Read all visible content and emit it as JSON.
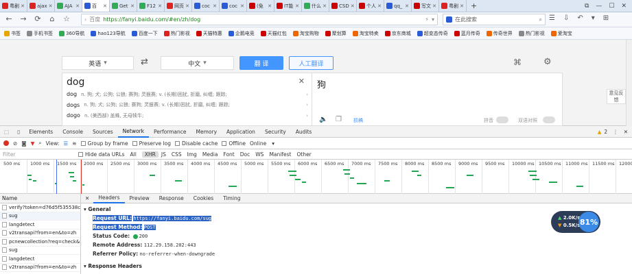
{
  "tabs": [
    {
      "title": "粤剧",
      "color": "#d22"
    },
    {
      "title": "ajax",
      "color": "#d22"
    },
    {
      "title": "AJA",
      "color": "#3a5"
    },
    {
      "title": "百",
      "color": "#2a5bd7",
      "active": true
    },
    {
      "title": "Get",
      "color": "#3a5"
    },
    {
      "title": "F12",
      "color": "#3a5"
    },
    {
      "title": "网页",
      "color": "#d22"
    },
    {
      "title": "coc",
      "color": "#2a5bd7"
    },
    {
      "title": "coc",
      "color": "#2a5bd7"
    },
    {
      "title": "(免",
      "color": "#c00"
    },
    {
      "title": "IT能",
      "color": "#c00"
    },
    {
      "title": "什么",
      "color": "#3a5"
    },
    {
      "title": "CSD",
      "color": "#c00"
    },
    {
      "title": "个人",
      "color": "#c00"
    },
    {
      "title": "qq_",
      "color": "#2a5bd7"
    },
    {
      "title": "写文",
      "color": "#c00"
    },
    {
      "title": "粤剧",
      "color": "#d22"
    }
  ],
  "nav": {
    "url_prefix": "百度",
    "url": "https://fanyi.baidu.com/#en/zh/dog",
    "search_placeholder": "在此搜索"
  },
  "bookmarks": [
    {
      "label": "书签",
      "color": "#e8a500"
    },
    {
      "label": "手机书签",
      "color": "#888"
    },
    {
      "label": "360导航",
      "color": "#3a5"
    },
    {
      "label": "hao123导航",
      "color": "#2a5bd7"
    },
    {
      "label": "百度一下",
      "color": "#2a5bd7"
    },
    {
      "label": "热门影视",
      "color": "#d22"
    },
    {
      "label": "天猫特惠",
      "color": "#c00"
    },
    {
      "label": "企鹅电竞",
      "color": "#2a5bd7"
    },
    {
      "label": "天猫红包",
      "color": "#c00"
    },
    {
      "label": "淘宝购物",
      "color": "#e60"
    },
    {
      "label": "聚划算",
      "color": "#c00"
    },
    {
      "label": "淘宝特卖",
      "color": "#e60"
    },
    {
      "label": "京东商城",
      "color": "#c00"
    },
    {
      "label": "超变态传奇",
      "color": "#2a5bd7"
    },
    {
      "label": "蓝月传奇",
      "color": "#c00"
    },
    {
      "label": "传奇世界",
      "color": "#e60"
    },
    {
      "label": "热门影视",
      "color": "#888"
    },
    {
      "label": "爱淘宝",
      "color": "#e60"
    }
  ],
  "translate": {
    "src_lang": "英语",
    "swap_icon": "⇄",
    "dst_lang": "中文",
    "translate_btn": "翻 译",
    "human_btn": "人工翻译",
    "input_word": "dog",
    "result": "狗",
    "suggestions": [
      {
        "word": "dog",
        "def": "n. 狗; 犬; 公狗; 公狼; 赛狗; 灵狠赛; v. (长期)困扰, 折磨, 纠缠; 跟踪;"
      },
      {
        "word": "dogs",
        "def": "n. 狗; 犬; 公狗; 公狼; 赛狗; 灵狠赛; v. (长期)困扰, 折磨, 纠缠; 跟踪;"
      },
      {
        "word": "dogo",
        "def": "n. (美西部) 盖蛛, 无母犊牛;"
      }
    ],
    "pinyin_label": "拼音",
    "parallel_label": "双语对照",
    "src_toggle_label": "损稿",
    "feedback": "意见反馈"
  },
  "devtools": {
    "tabs": [
      "Elements",
      "Console",
      "Sources",
      "Network",
      "Performance",
      "Memory",
      "Application",
      "Security",
      "Audits"
    ],
    "active_tab": "Network",
    "warning_count": "2",
    "toolbar": {
      "view": "View:",
      "group": "Group by frame",
      "preserve": "Preserve log",
      "disable_cache": "Disable cache",
      "offline": "Offline",
      "online": "Online"
    },
    "filter": {
      "placeholder": "Filter",
      "hide_data": "Hide data URLs",
      "all": "All",
      "types": [
        "XHR",
        "JS",
        "CSS",
        "Img",
        "Media",
        "Font",
        "Doc",
        "WS",
        "Manifest",
        "Other"
      ]
    },
    "ticks": [
      "500 ms",
      "1000 ms",
      "1500 ms",
      "2000 ms",
      "2500 ms",
      "3000 ms",
      "3500 ms",
      "4000 ms",
      "4500 ms",
      "5000 ms",
      "5500 ms",
      "6000 ms",
      "6500 ms",
      "7000 ms",
      "7500 ms",
      "8000 ms",
      "8500 ms",
      "9000 ms",
      "9500 ms",
      "10000 ms",
      "10500 ms",
      "11000 ms",
      "11500 ms",
      "12000"
    ],
    "name_header": "Name",
    "requests": [
      "verify?token=d76d5f535538c",
      "sug",
      "langdetect",
      "v2transapi?from=en&to=zh",
      "pcnewcollection?req=check&f",
      "sug",
      "langdetect",
      "v2transapi?from=en&to=zh"
    ],
    "detail_tabs": [
      "Headers",
      "Preview",
      "Response",
      "Cookies",
      "Timing"
    ],
    "general_title": "General",
    "request_url_k": "Request URL:",
    "request_url_v": "https://fanyi.baidu.com/sug",
    "request_method_k": "Request Method:",
    "request_method_v": "POST",
    "status_k": "Status Code:",
    "status_v": "200",
    "remote_k": "Remote Address:",
    "remote_v": "112.29.158.202:443",
    "referrer_k": "Referrer Policy:",
    "referrer_v": "no-referrer-when-downgrade",
    "response_headers": "Response Headers"
  },
  "netwidget": {
    "up": "2.0K/s",
    "down": "0.5K/s",
    "percent": "81%"
  }
}
